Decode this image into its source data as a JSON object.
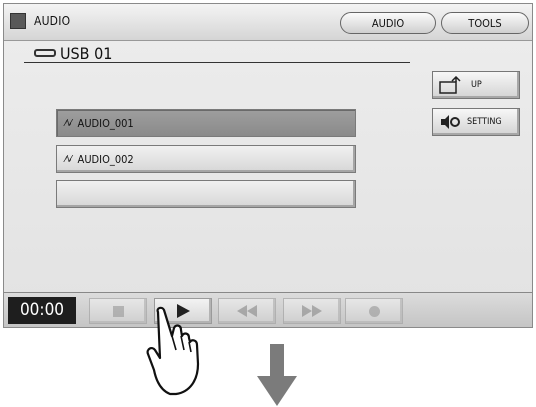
{
  "titlebar": {
    "title": "AUDIO",
    "tabs": [
      "AUDIO",
      "TOOLS"
    ]
  },
  "browser": {
    "device": "USB 01",
    "files": [
      {
        "name": "AUDIO_001",
        "selected": true
      },
      {
        "name": "AUDIO_002",
        "selected": false
      },
      {
        "name": "",
        "selected": false
      }
    ]
  },
  "side_buttons": {
    "up": "UP",
    "setting": "SETTING"
  },
  "transport": {
    "time": "00:00"
  },
  "icons": {
    "usb": "usb-drive-icon",
    "wave": "audio-wave-icon",
    "folder_up": "folder-up-icon",
    "setting": "speaker-setting-icon",
    "stop": "stop-icon",
    "play": "play-icon",
    "rewind": "rewind-icon",
    "fast_forward": "fast-forward-icon",
    "record": "record-icon"
  },
  "colors": {
    "selected_row": "#8f8f8f",
    "time_bg": "#1e1e1e"
  }
}
